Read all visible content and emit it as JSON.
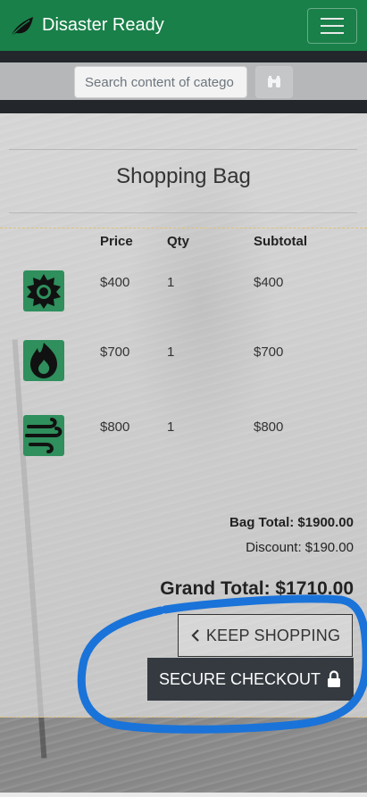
{
  "navbar": {
    "brand": "Disaster Ready",
    "brand_icon": "leaf-icon",
    "menu_icon": "hamburger-icon",
    "color": "#198049"
  },
  "search": {
    "placeholder": "Search content of catego",
    "button_icon": "binoculars-icon"
  },
  "bag": {
    "title": "Shopping Bag",
    "columns": [
      "Price",
      "Qty",
      "Subtotal"
    ],
    "items": [
      {
        "icon": "sun-icon",
        "price": "$400",
        "qty": "1",
        "subtotal": "$400"
      },
      {
        "icon": "flame-icon",
        "price": "$700",
        "qty": "1",
        "subtotal": "$700"
      },
      {
        "icon": "wind-icon",
        "price": "$800",
        "qty": "1",
        "subtotal": "$800"
      }
    ],
    "bag_total": "Bag Total: $1900.00",
    "discount": "Discount: $190.00",
    "grand_total": "Grand Total: $1710.00",
    "keep_shopping": "KEEP SHOPPING",
    "checkout": "SECURE CHECKOUT",
    "icon_color": "#2f8f5d",
    "annotation_color": "#1a73d9"
  }
}
